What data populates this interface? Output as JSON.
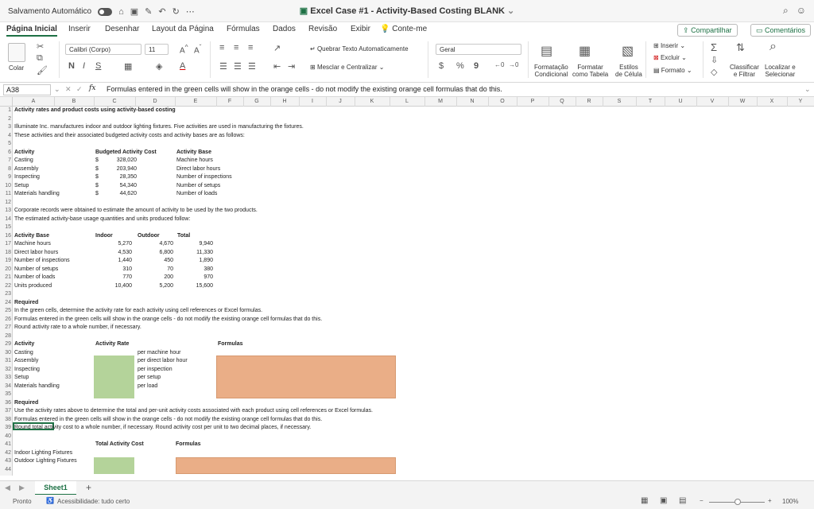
{
  "titlebar": {
    "autosave_label": "Salvamento Automático",
    "toggle_state": "O",
    "title": "Excel Case #1 - Activity-Based Costing BLANK"
  },
  "tabs": [
    "Página Inicial",
    "Inserir",
    "Desenhar",
    "Layout da Página",
    "Fórmulas",
    "Dados",
    "Revisão",
    "Exibir"
  ],
  "tell_me": "Conte-me",
  "share_label": "Compartilhar",
  "comments_label": "Comentários",
  "ribbon": {
    "paste": "Colar",
    "font_name": "Calibri (Corpo)",
    "font_size": "11",
    "bold": "N",
    "italic": "I",
    "underline": "S",
    "wrap_text": "Quebrar Texto Automaticamente",
    "merge_center": "Mesclar e Centralizar",
    "number_format": "Geral",
    "currency": "$",
    "percent": "%",
    "comma": "9",
    "cond_format": [
      "Formatação",
      "Condicional"
    ],
    "format_table": [
      "Formatar",
      "como Tabela"
    ],
    "cell_styles": [
      "Estilos",
      "de Célula"
    ],
    "insert": "Inserir",
    "delete": "Excluir",
    "format": "Formato",
    "sort_filter": [
      "Classificar",
      "e Filtrar"
    ],
    "find_select": [
      "Localizar e",
      "Selecionar"
    ]
  },
  "formula_bar": {
    "name_box": "A38",
    "content": "Formulas entered in the green cells will show in the orange cells - do not modify the existing orange cell formulas that do this."
  },
  "columns": [
    "A",
    "B",
    "C",
    "D",
    "E",
    "F",
    "G",
    "H",
    "I",
    "J",
    "K",
    "L",
    "M",
    "N",
    "O",
    "P",
    "Q",
    "R",
    "S",
    "T",
    "U",
    "V",
    "W",
    "X",
    "Y"
  ],
  "sheet": {
    "r1": "Activity rates and product costs using activity-based costing",
    "r3": "Illuminate Inc. manufactures indoor and outdoor lighting fixtures. Five activities are used in manufacturing the fixtures.",
    "r4": "These activities and their associated budgeted activity costs and activity bases are as follows:",
    "act_head": "Activity",
    "budget_head": "Budgeted Activity Cost",
    "base_head": "Activity Base",
    "activities": [
      {
        "name": "Casting",
        "cur": "$",
        "cost": "328,020",
        "base": "Machine hours"
      },
      {
        "name": "Assembly",
        "cur": "$",
        "cost": "203,940",
        "base": "Direct labor hours"
      },
      {
        "name": "Inspecting",
        "cur": "$",
        "cost": "28,350",
        "base": "Number of inspections"
      },
      {
        "name": "Setup",
        "cur": "$",
        "cost": "54,340",
        "base": "Number of setups"
      },
      {
        "name": "Materials handling",
        "cur": "$",
        "cost": "44,620",
        "base": "Number of loads"
      }
    ],
    "r13": "Corporate records were obtained to estimate the amount of activity to be used by the two products.",
    "r14": "The estimated activity-base usage quantities and units produced follow:",
    "base_table_head": [
      "Activity Base",
      "Indoor",
      "Outdoor",
      "Total"
    ],
    "base_rows": [
      [
        "Machine hours",
        "5,270",
        "4,670",
        "9,940"
      ],
      [
        "Direct labor hours",
        "4,530",
        "6,800",
        "11,330"
      ],
      [
        "Number of inspections",
        "1,440",
        "450",
        "1,890"
      ],
      [
        "Number of setups",
        "310",
        "70",
        "380"
      ],
      [
        "Number of loads",
        "770",
        "200",
        "970"
      ],
      [
        "Units produced",
        "10,400",
        "5,200",
        "15,600"
      ]
    ],
    "required1": "Required",
    "r25": "In the green cells, determine the activity rate for each activity using cell references or Excel formulas.",
    "r26": "Formulas entered in the green cells will show in the orange cells - do not modify the existing orange cell formulas that do this.",
    "r27": "Round activity rate to a whole number, if necessary.",
    "rate_head": [
      "Activity",
      "Activity Rate",
      "Formulas"
    ],
    "rate_rows": [
      [
        "Casting",
        "per machine hour"
      ],
      [
        "Assembly",
        "per direct labor hour"
      ],
      [
        "Inspecting",
        "per inspection"
      ],
      [
        "Setup",
        "per setup"
      ],
      [
        "Materials handling",
        "per load"
      ]
    ],
    "required2": "Required",
    "r37": "Use the activity rates above to determine the total and per-unit activity costs associated with each product using cell references or Excel formulas.",
    "r38": "Formulas entered in the green cells will show in the orange cells - do not modify the existing orange cell formulas that do this.",
    "r39": "Round total activity cost to a whole number, if necessary. Round activity cost per unit to two decimal places, if necessary.",
    "total_head": [
      "Total Activity Cost",
      "Formulas"
    ],
    "total_rows": [
      "Indoor Lighting Fixtures",
      "Outdoor Lighting Fixtures"
    ]
  },
  "sheet_tab": "Sheet1",
  "status": {
    "ready": "Pronto",
    "accessibility": "Acessibilidade: tudo certo",
    "zoom": "100%"
  },
  "colors": {
    "accent": "#1e7145",
    "green_cell": "#b4d39a",
    "orange_cell": "#eaae87"
  }
}
